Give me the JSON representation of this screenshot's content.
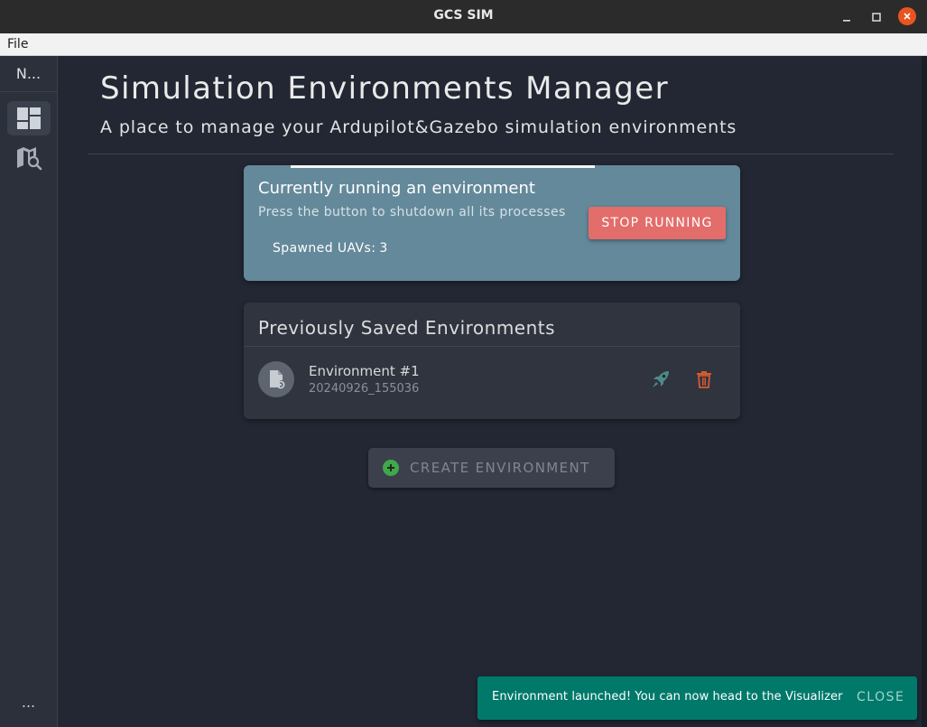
{
  "window": {
    "title": "GCS SIM"
  },
  "menubar": {
    "file_label": "File"
  },
  "rail": {
    "header_label": "N...",
    "items": [
      {
        "name": "dashboard",
        "icon": "dashboard-icon",
        "active": true
      },
      {
        "name": "map-search",
        "icon": "map-search-icon",
        "active": false
      }
    ],
    "more_label": "..."
  },
  "page": {
    "title": "Simulation Environments Manager",
    "subtitle": "A place to manage your Ardupilot&Gazebo simulation environments"
  },
  "running": {
    "title": "Currently running an environment",
    "description": "Press the button to shutdown all its processes",
    "uavs_label": "Spawned UAVs:",
    "uavs_count": "3",
    "stop_label": "STOP RUNNING",
    "card_color": "#64899a",
    "stop_color": "#e36d6a"
  },
  "saved": {
    "title": "Previously Saved Environments",
    "items": [
      {
        "name": "Environment #1",
        "date": "20240926_155036",
        "avatar_icon": "file-settings-icon",
        "launch_icon": "rocket-icon",
        "delete_icon": "trash-icon"
      }
    ]
  },
  "create": {
    "label": "CREATE ENVIRONMENT",
    "icon": "plus-circle-icon",
    "icon_color": "#3fa84a"
  },
  "snackbar": {
    "message": "Environment launched! You can now head to the Visualizer",
    "action_label": "CLOSE",
    "color": "#00796b"
  }
}
